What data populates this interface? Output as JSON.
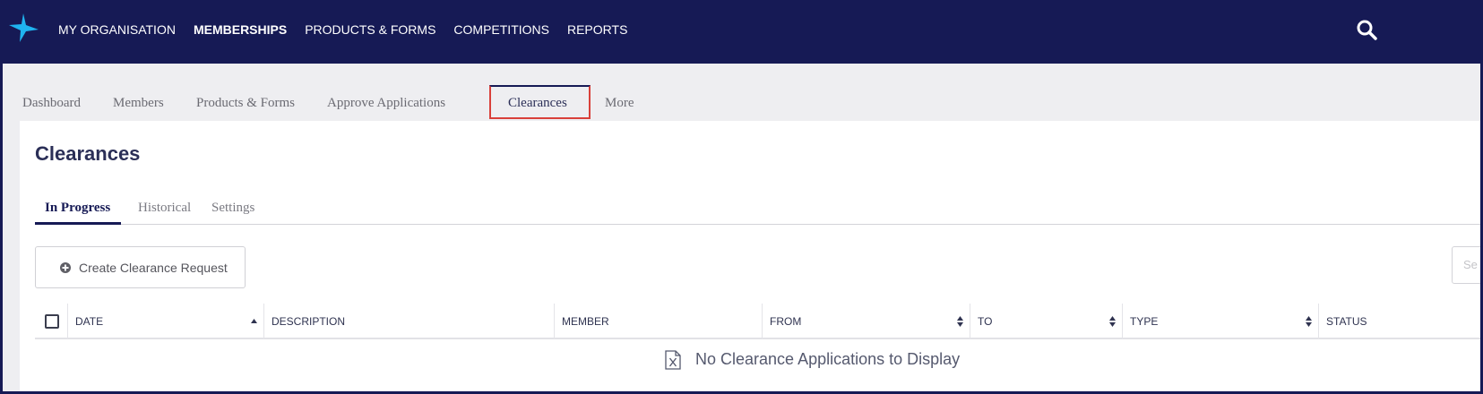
{
  "colors": {
    "nav_bg": "#161a55",
    "highlight_box": "#d9403a",
    "logo": "#1fb4f0"
  },
  "topnav": {
    "logo_icon": "star-logo-icon",
    "items": [
      {
        "label": "MY ORGANISATION"
      },
      {
        "label": "MEMBERSHIPS",
        "active": true
      },
      {
        "label": "PRODUCTS & FORMS"
      },
      {
        "label": "COMPETITIONS"
      },
      {
        "label": "REPORTS"
      }
    ],
    "search_icon": "search-icon"
  },
  "subnav": {
    "items": [
      {
        "label": "Dashboard"
      },
      {
        "label": "Members"
      },
      {
        "label": "Products & Forms"
      },
      {
        "label": "Approve Applications"
      },
      {
        "label": "Clearances",
        "active": true
      },
      {
        "label": "More"
      }
    ]
  },
  "page": {
    "title": "Clearances",
    "tabs": [
      {
        "label": "In Progress",
        "active": true
      },
      {
        "label": "Historical"
      },
      {
        "label": "Settings"
      }
    ],
    "create_button": "Create Clearance Request",
    "search_placeholder": "Se",
    "table": {
      "columns": [
        {
          "label": "DATE",
          "sortable": "asc"
        },
        {
          "label": "DESCRIPTION"
        },
        {
          "label": "MEMBER"
        },
        {
          "label": "FROM",
          "sortable": "both"
        },
        {
          "label": "TO",
          "sortable": "both"
        },
        {
          "label": "TYPE",
          "sortable": "both"
        },
        {
          "label": "STATUS"
        }
      ],
      "empty_message": "No Clearance Applications to Display",
      "empty_icon": "excel-file-icon"
    }
  }
}
